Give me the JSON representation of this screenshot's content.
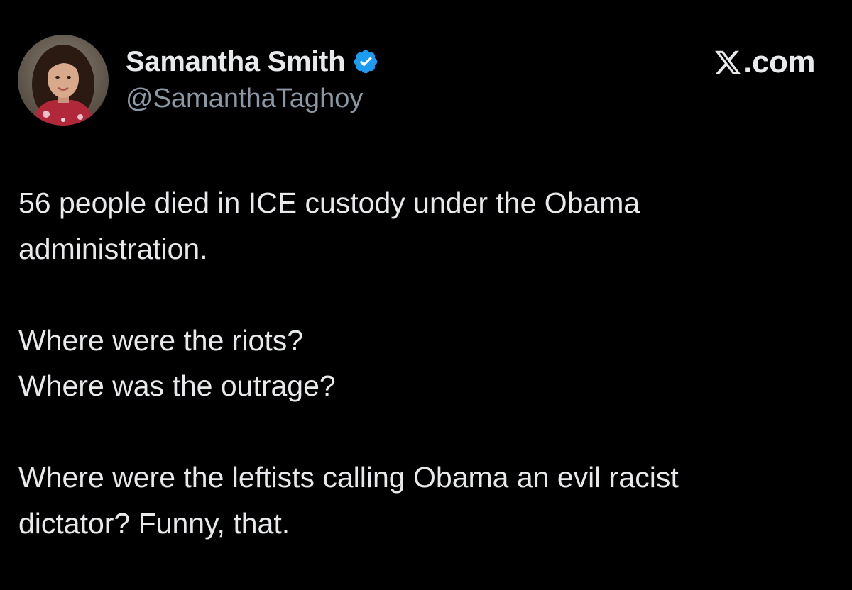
{
  "author": {
    "display_name": "Samantha Smith",
    "handle": "@SamanthaTaghoy",
    "verified": true,
    "avatar_icon": "profile-photo"
  },
  "brand": {
    "text": ".com",
    "icon": "x-logo-icon"
  },
  "tweet": {
    "paragraphs": [
      {
        "lines": [
          "56 people died in ICE custody under the Obama",
          "administration."
        ]
      },
      {
        "lines": [
          "Where were the riots?",
          "Where was the outrage?"
        ]
      },
      {
        "lines": [
          "Where were the leftists calling Obama an evil racist",
          "dictator? Funny, that."
        ]
      }
    ]
  },
  "colors": {
    "background": "#000000",
    "text": "#e7e9ea",
    "secondary_text": "#8b98a5",
    "verified_badge": "#1d9bf0"
  }
}
